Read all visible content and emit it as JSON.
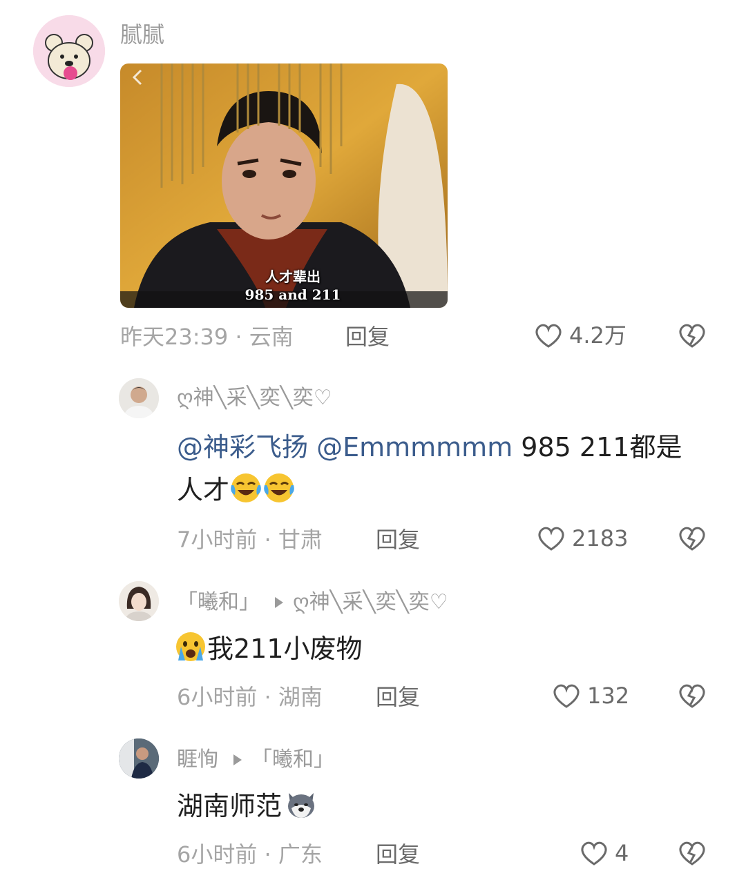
{
  "thread": {
    "top_comment": {
      "username": "腻腻",
      "image": {
        "caption_line1": "人才辈出",
        "caption_line2": "985 and 211"
      },
      "time": "昨天23:39",
      "location": "云南",
      "reply_label": "回复",
      "likes": "4.2万",
      "avatar_icon": "bear-avatar-icon"
    },
    "replies": [
      {
        "username": "ღ神╲采╲奕╲奕♡",
        "text_mentions": [
          "@神彩飞扬",
          "@Emmmmmm"
        ],
        "text_rest": " 985  211都是",
        "text_line2": "人才",
        "emojis": [
          "laugh-cry-emoji",
          "laugh-cry-emoji"
        ],
        "time": "7小时前",
        "location": "甘肃",
        "reply_label": "回复",
        "likes": "2183"
      },
      {
        "username": "「曦和」",
        "reply_to": "ღ神╲采╲奕╲奕♡",
        "text": "我211小废物",
        "emojis": [
          "crying-emoji"
        ],
        "time": "6小时前",
        "location": "湖南",
        "reply_label": "回复",
        "likes": "132"
      },
      {
        "username": "睚恂",
        "reply_to": "「曦和」",
        "text": "湖南师范",
        "emojis": [
          "husky-dog-emoji"
        ],
        "time": "6小时前",
        "location": "广东",
        "reply_label": "回复",
        "likes": "4"
      }
    ],
    "separator": " · "
  },
  "colors": {
    "mention": "#3b5c8c",
    "meta": "#a5a5a5",
    "text": "#1f1f1f"
  }
}
